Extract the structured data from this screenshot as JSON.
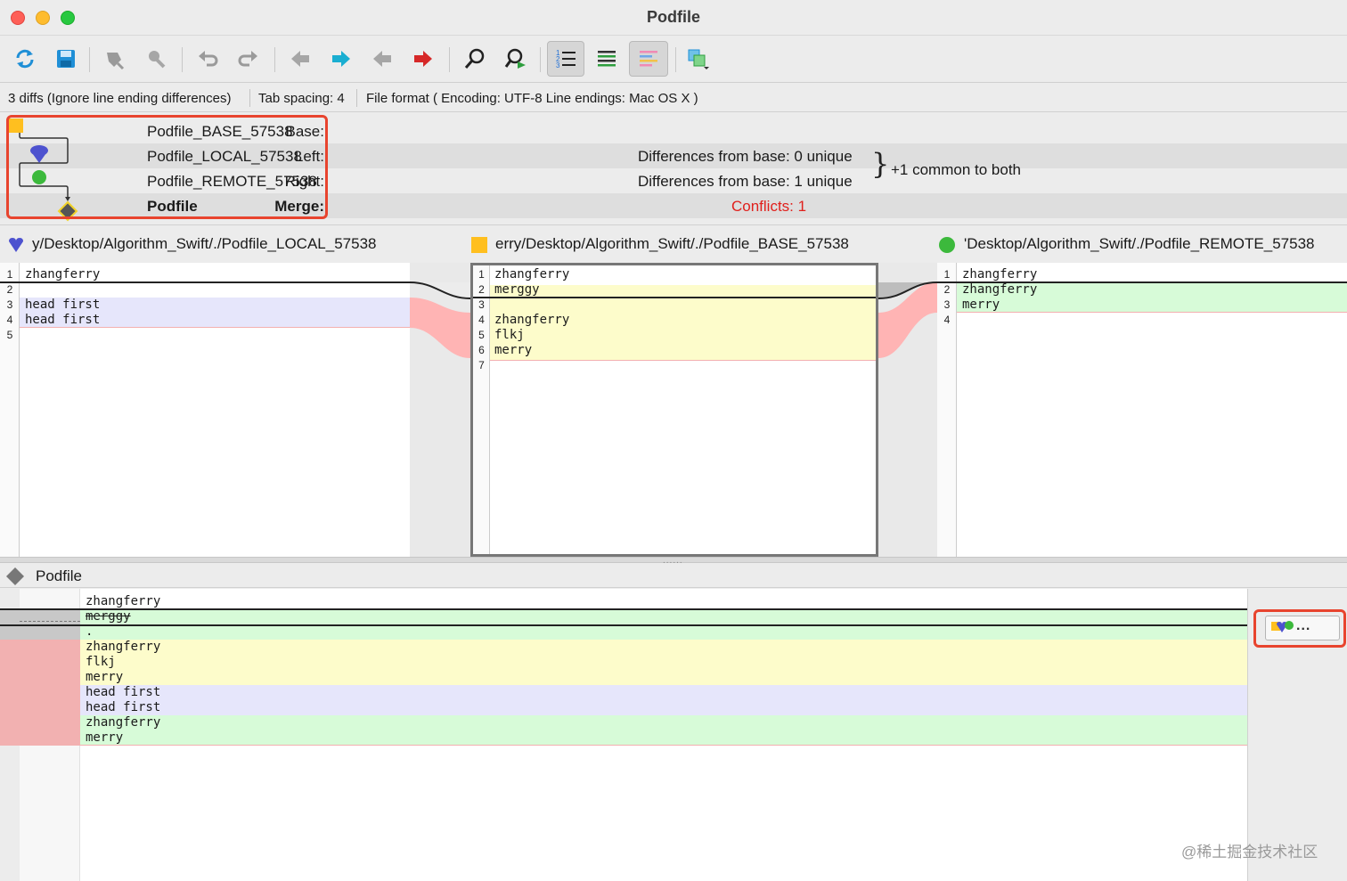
{
  "window": {
    "title": "Podfile"
  },
  "toolbar": {
    "buttons": [
      {
        "name": "reload-icon"
      },
      {
        "name": "save-icon"
      },
      {
        "name": "merge-down-icon"
      },
      {
        "name": "merge-down-disabled-icon"
      },
      {
        "name": "undo-icon"
      },
      {
        "name": "redo-icon"
      },
      {
        "name": "prev-diff-icon"
      },
      {
        "name": "next-diff-icon"
      },
      {
        "name": "prev-conflict-icon"
      },
      {
        "name": "next-conflict-icon"
      },
      {
        "name": "find-icon"
      },
      {
        "name": "find-next-icon"
      },
      {
        "name": "line-numbers-icon"
      },
      {
        "name": "show-whitespace-icon"
      },
      {
        "name": "show-diffs-icon"
      },
      {
        "name": "window-split-icon"
      }
    ]
  },
  "status": {
    "diffs": "3 diffs (Ignore line ending differences)",
    "tab_spacing": "Tab spacing: 4",
    "file_format": "File format ( Encoding: UTF-8  Line endings: Mac OS X )"
  },
  "summary": {
    "base_label": "Base:",
    "base_value": "Podfile_BASE_57538",
    "left_label": "Left:",
    "left_value": "Podfile_LOCAL_57538",
    "right_label": "Right:",
    "right_value": "Podfile_REMOTE_57538",
    "merge_label": "Merge:",
    "merge_value": "Podfile",
    "left_diff": "Differences from base: 0 unique",
    "right_diff": "Differences from base: 1 unique",
    "common": "+1 common to both",
    "conflicts": "Conflicts: 1",
    "brace": "}"
  },
  "files": {
    "left": "y/Desktop/Algorithm_Swift/./Podfile_LOCAL_57538",
    "base": "erry/Desktop/Algorithm_Swift/./Podfile_BASE_57538",
    "right": "'Desktop/Algorithm_Swift/./Podfile_REMOTE_57538"
  },
  "left_pane": {
    "lines": [
      {
        "n": "1",
        "t": "zhangferry"
      },
      {
        "n": "2",
        "t": ""
      },
      {
        "n": "3",
        "t": "head first"
      },
      {
        "n": "4",
        "t": "head first"
      },
      {
        "n": "5",
        "t": ""
      }
    ]
  },
  "base_pane": {
    "lines": [
      {
        "n": "1",
        "t": "zhangferry"
      },
      {
        "n": "2",
        "t": "merggy"
      },
      {
        "n": "3",
        "t": ""
      },
      {
        "n": "4",
        "t": "zhangferry"
      },
      {
        "n": "5",
        "t": "flkj"
      },
      {
        "n": "6",
        "t": "merry"
      },
      {
        "n": "7",
        "t": ""
      }
    ]
  },
  "right_pane": {
    "lines": [
      {
        "n": "1",
        "t": "zhangferry"
      },
      {
        "n": "2",
        "t": "zhangferry"
      },
      {
        "n": "3",
        "t": "merry"
      },
      {
        "n": "4",
        "t": ""
      }
    ]
  },
  "merge": {
    "title": "Podfile",
    "lines": [
      "zhangferry",
      "merggy",
      ".",
      "zhangferry",
      "flkj",
      "merry",
      "head first",
      "head first",
      "zhangferry",
      "merry"
    ],
    "picker_ellipsis": "..."
  },
  "watermark": "@稀土掘金技术社区",
  "colors": {
    "accent_red": "#e8442e",
    "conflict_text": "#e0201c",
    "diff_blue": "#e6e6fb",
    "diff_yellow": "#fdfccb",
    "diff_green": "#d7fbd8",
    "diff_pink": "#ffd1d1"
  }
}
